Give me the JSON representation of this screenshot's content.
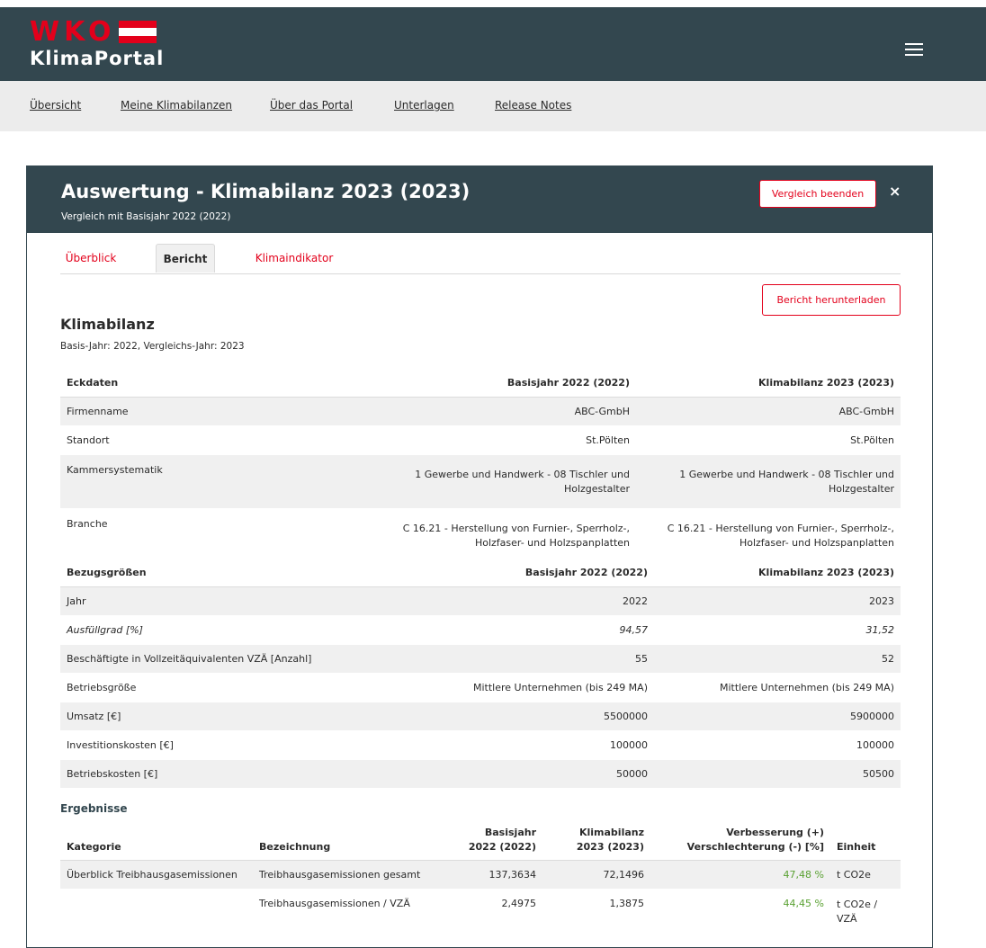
{
  "header": {
    "logo_letters": "WKO",
    "logo_sub": "KlimaPortal"
  },
  "nav": [
    "Übersicht",
    "Meine Klimabilanzen",
    "Über das Portal",
    "Unterlagen",
    "Release Notes"
  ],
  "card": {
    "title": "Auswertung - Klimabilanz 2023 (2023)",
    "subtitle": "Vergleich mit Basisjahr 2022 (2022)",
    "end_button": "Vergleich beenden",
    "close": "×"
  },
  "tabs": [
    "Überblick",
    "Bericht",
    "Klimaindikator"
  ],
  "download_button": "Bericht herunterladen",
  "section": {
    "title": "Klimabilanz",
    "subtitle": "Basis-Jahr: 2022, Vergleichs-Jahr: 2023"
  },
  "eckdaten": {
    "headers": [
      "Eckdaten",
      "Basisjahr 2022 (2022)",
      "Klimabilanz 2023 (2023)"
    ],
    "rows": [
      [
        "Firmenname",
        "ABC-GmbH",
        "ABC-GmbH"
      ],
      [
        "Standort",
        "St.Pölten",
        "St.Pölten"
      ],
      [
        "Kammersystematik",
        "1 Gewerbe und Handwerk - 08 Tischler und Holzgestalter",
        "1 Gewerbe und Handwerk - 08 Tischler und Holzgestalter"
      ],
      [
        "Branche",
        "C 16.21 - Herstellung von Furnier-, Sperrholz-, Holzfaser- und Holzspanplatten",
        "C 16.21 - Herstellung von Furnier-, Sperrholz-, Holzfaser- und Holzspanplatten"
      ]
    ]
  },
  "bezug": {
    "headers": [
      "Bezugsgrößen",
      "Basisjahr 2022 (2022)",
      "Klimabilanz 2023 (2023)"
    ],
    "rows": [
      [
        "Jahr",
        "2022",
        "2023"
      ],
      [
        "Ausfüllgrad [%]",
        "94,57",
        "31,52"
      ],
      [
        "Beschäftigte in Vollzeitäquivalenten VZÄ [Anzahl]",
        "55",
        "52"
      ],
      [
        "Betriebsgröße",
        "Mittlere Unternehmen (bis 249 MA)",
        "Mittlere Unternehmen (bis 249 MA)"
      ],
      [
        "Umsatz [€]",
        "5500000",
        "5900000"
      ],
      [
        "Investitionskosten [€]",
        "100000",
        "100000"
      ],
      [
        "Betriebskosten [€]",
        "50000",
        "50500"
      ]
    ]
  },
  "ergebnisse": {
    "title": "Ergebnisse",
    "headers": [
      "Kategorie",
      "Bezeichnung",
      "Basisjahr 2022 (2022)",
      "Klimabilanz 2023 (2023)",
      "Verbesserung (+) Verschlechterung (-) [%]",
      "Einheit"
    ],
    "rows": [
      [
        "Überblick Treibhausgasemissionen",
        "Treibhausgasemissionen gesamt",
        "137,3634",
        "72,1496",
        "47,48 %",
        "t CO2e"
      ],
      [
        "",
        "Treibhausgasemissionen / VZÄ",
        "2,4975",
        "1,3875",
        "44,45 %",
        "t CO2e / VZÄ"
      ]
    ]
  }
}
